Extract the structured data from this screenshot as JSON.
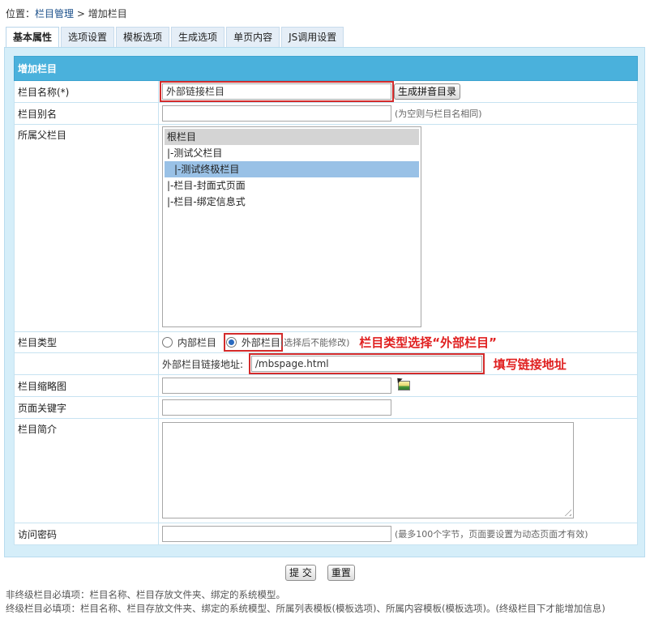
{
  "breadcrumb": {
    "prefix": "位置：",
    "link": "栏目管理",
    "separator": " > ",
    "current": "增加栏目"
  },
  "tabs": [
    {
      "label": "基本属性",
      "active": true
    },
    {
      "label": "选项设置"
    },
    {
      "label": "模板选项"
    },
    {
      "label": "生成选项"
    },
    {
      "label": "单页内容"
    },
    {
      "label": "JS调用设置"
    }
  ],
  "form": {
    "header": "增加栏目",
    "name_label": "栏目名称(*)",
    "name_value": "外部链接栏目",
    "pinyin_button": "生成拼音目录",
    "alias_label": "栏目别名",
    "alias_value": "",
    "alias_hint": "(为空则与栏目名相同)",
    "parent_label": "所属父栏目",
    "parent_options": [
      {
        "text": "根栏目",
        "state": "root"
      },
      {
        "text": "|-测试父栏目"
      },
      {
        "text": "  |-测试终极栏目",
        "state": "selected"
      },
      {
        "text": "|-栏目-封面式页面"
      },
      {
        "text": "|-栏目-绑定信息式"
      }
    ],
    "type_label": "栏目类型",
    "type_option_internal": "内部栏目",
    "type_option_external": "外部栏目",
    "type_hint": "(选择后不能修改)",
    "type_annotation": "栏目类型选择“外部栏目”",
    "link_label": "外部栏目链接地址:",
    "link_value": "/mbspage.html",
    "link_annotation": "填写链接地址",
    "thumb_label": "栏目缩略图",
    "thumb_value": "",
    "keywords_label": "页面关键字",
    "keywords_value": "",
    "intro_label": "栏目简介",
    "intro_value": "",
    "password_label": "访问密码",
    "password_value": "",
    "password_hint": "(最多100个字节，页面要设置为动态页面才有效)"
  },
  "actions": {
    "submit": "提 交",
    "reset": "重置"
  },
  "notes": {
    "line1": "非终级栏目必填项：栏目名称、栏目存放文件夹、绑定的系统模型。",
    "line2": "终级栏目必填项：栏目名称、栏目存放文件夹、绑定的系统模型、所属列表模板(模板选项)、所属内容模板(模板选项)。(终级栏目下才能增加信息)"
  },
  "colors": {
    "header_bg": "#4ab1dc",
    "panel_bg": "#d5eef9",
    "annotation_red": "#e02020",
    "selected_item": "#99c1e6"
  },
  "icons": {
    "thumbnail_picker": "image-picker-icon"
  }
}
